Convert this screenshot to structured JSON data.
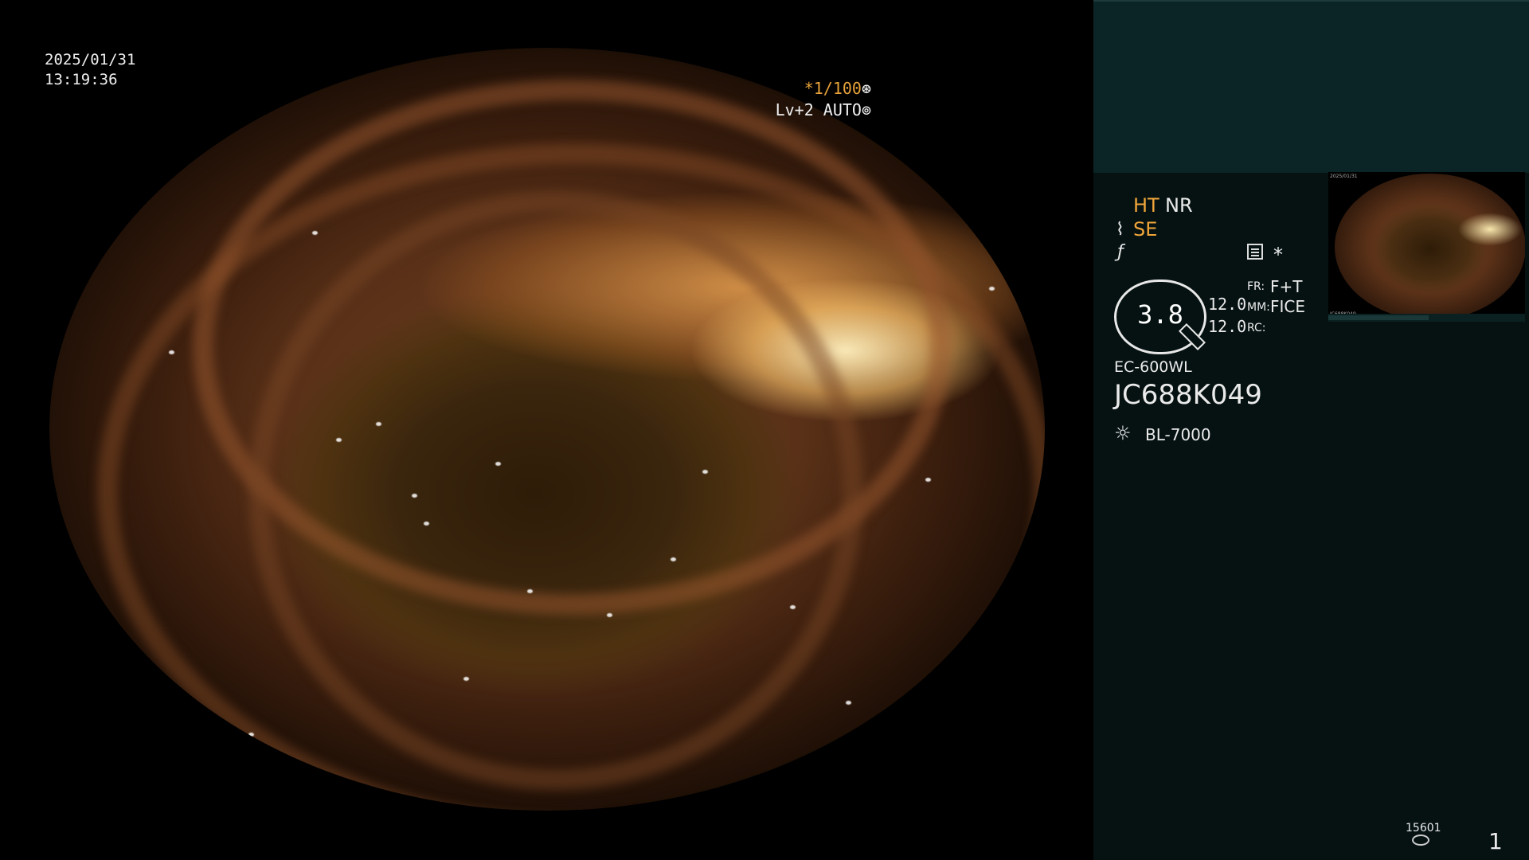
{
  "scope": {
    "date": "2025/01/31",
    "time": "13:19:36",
    "shutter": "*1/100",
    "shutter_icon": "aperture-icon",
    "level": "Lv+2 AUTO",
    "level_icon": "iris-icon"
  },
  "panel": {
    "ht": "HT",
    "nr": "NR",
    "se": "SE",
    "se_icon": "tool-hook-icon",
    "f_icon": "enhance-f-icon",
    "list_icon": "settings-list-icon",
    "asterisk": "*",
    "magnification": "3.8",
    "val1": "12.0",
    "val2": "12.0",
    "fr_label": "FR:",
    "fr_value": "F+T",
    "mm_label": "MM:",
    "mm_value": "FICE",
    "rc_label": "RC:",
    "rc_value": "",
    "scope_model": "EC-600WL",
    "serial": "JC688K049",
    "light_icon": "light-source-icon",
    "light_source": "BL-7000",
    "storage_count": "15601",
    "storage_icon": "disk-storage-icon",
    "page_number": "1"
  },
  "colors": {
    "accent": "#f0a53a",
    "panel_bg": "#061212",
    "panel_top": "#0b2426"
  }
}
